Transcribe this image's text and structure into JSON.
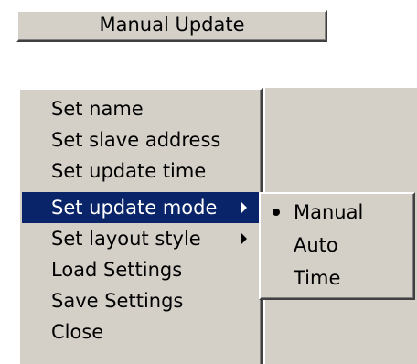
{
  "button": {
    "label": "Manual Update"
  },
  "menu": {
    "items": [
      {
        "label": "Set name",
        "has_submenu": false
      },
      {
        "label": "Set slave address",
        "has_submenu": false
      },
      {
        "label": "Set update time",
        "has_submenu": false
      },
      {
        "label": "Set update mode",
        "has_submenu": true,
        "highlighted": true
      },
      {
        "label": "Set layout style",
        "has_submenu": true
      },
      {
        "label": "Load Settings",
        "has_submenu": false
      },
      {
        "label": "Save Settings",
        "has_submenu": false
      },
      {
        "label": "Close",
        "has_submenu": false
      }
    ]
  },
  "submenu": {
    "items": [
      {
        "label": "Manual",
        "selected": true
      },
      {
        "label": "Auto",
        "selected": false
      },
      {
        "label": "Time",
        "selected": false
      }
    ]
  },
  "colors": {
    "menu_background": "#d4d0c8",
    "highlight_background": "#0a246a",
    "highlight_text": "#ffffff"
  }
}
